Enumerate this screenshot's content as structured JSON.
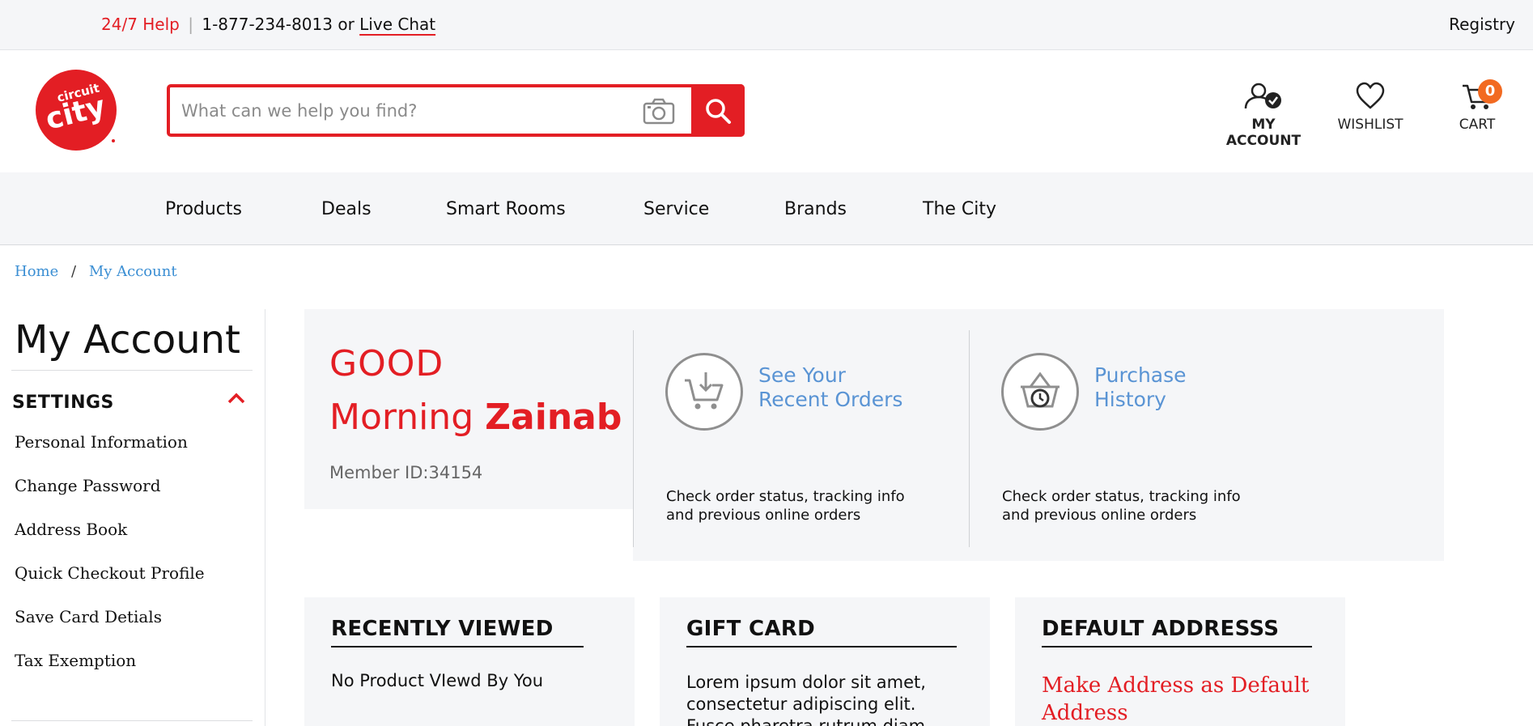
{
  "topbar": {
    "help_label": "24/7 Help",
    "separator": "|",
    "phone": "1-877-234-8013",
    "or_text": "or",
    "live_chat": "Live Chat",
    "registry": "Registry"
  },
  "header": {
    "logo_text_top": "circuit",
    "logo_text_main": "city",
    "search_placeholder": "What can we help you find?",
    "account_label": "MY ACCOUNT",
    "wishlist_label": "WISHLIST",
    "cart_label": "CART",
    "cart_count": "0"
  },
  "colors": {
    "brand_red": "#e31e24",
    "link_blue": "#5a94d4",
    "badge_orange": "#f26a21",
    "panel_gray": "#f5f6f8"
  },
  "nav": {
    "items": [
      "Products",
      "Deals",
      "Smart Rooms",
      "Service",
      "Brands",
      "The City"
    ]
  },
  "breadcrumb": {
    "home": "Home",
    "separator": "/",
    "current": "My Account"
  },
  "sidebar": {
    "title": "My Account",
    "section": "SETTINGS",
    "links": [
      "Personal Information",
      "Change Password",
      "Address Book",
      "Quick Checkout Profile",
      "Save Card Detials",
      "Tax Exemption"
    ]
  },
  "greeting": {
    "line1": "GOOD",
    "line2": "Morning",
    "name": "Zainab",
    "member_id": "Member ID:34154"
  },
  "quick_links": [
    {
      "icon": "cart-download-icon",
      "title_line1": "See Your",
      "title_line2": "Recent Orders",
      "desc_line1": "Check order status, tracking info",
      "desc_line2": "and previous online orders"
    },
    {
      "icon": "basket-clock-icon",
      "title_line1": "Purchase",
      "title_line2": "History",
      "desc_line1": "Check order status, tracking info",
      "desc_line2": "and previous online orders"
    }
  ],
  "cards": {
    "recent": {
      "title": "RECENTLY VIEWED",
      "body": "No Product VIewd By You"
    },
    "gift": {
      "title": "GIFT CARD",
      "body": "Lorem ipsum dolor sit amet, consectetur adipiscing elit. Fusce pharetra rutrum diam"
    },
    "address": {
      "title": "DEFAULT ADDRESSS",
      "action": "Make Address as Default Address"
    }
  }
}
